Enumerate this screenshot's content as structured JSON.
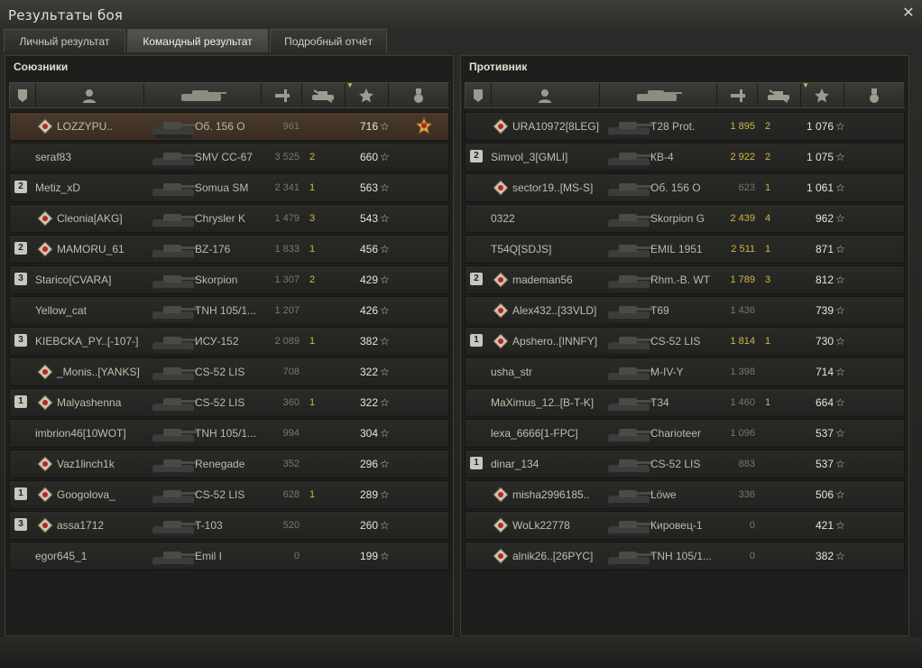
{
  "window": {
    "title": "Результаты боя",
    "close_icon": "close-icon"
  },
  "tabs": [
    {
      "label": "Личный результат"
    },
    {
      "label": "Командный результат"
    },
    {
      "label": "Подробный отчёт"
    }
  ],
  "allies": {
    "title": "Союзники",
    "rows": [
      {
        "platoon": "",
        "badge": "clan-emblem-icon",
        "name": "LOZZYPU..",
        "vehicle": "Об. 156 О",
        "damage": "961",
        "frags": "",
        "xp": "716",
        "medal": "order-medal-icon"
      },
      {
        "platoon": "",
        "badge": "",
        "name": "seraf83",
        "vehicle": "SMV CC-67",
        "damage": "3 525",
        "frags": "2",
        "xp": "660",
        "medal": ""
      },
      {
        "platoon": "2",
        "badge": "",
        "name": "Metiz_xD",
        "vehicle": "Somua SM",
        "damage": "2 341",
        "frags": "1",
        "xp": "563",
        "medal": ""
      },
      {
        "platoon": "",
        "badge": "clan-emblem-icon",
        "name": "Cleonia[AKG]",
        "vehicle": "Chrysler K",
        "damage": "1 479",
        "frags": "3",
        "xp": "543",
        "medal": ""
      },
      {
        "platoon": "2",
        "badge": "clan-emblem-icon",
        "name": "MAMORU_61",
        "vehicle": "BZ-176",
        "damage": "1 833",
        "frags": "1",
        "xp": "456",
        "medal": ""
      },
      {
        "platoon": "3",
        "badge": "",
        "name": "Starico[CVARA]",
        "vehicle": "Skorpion",
        "damage": "1 307",
        "frags": "2",
        "xp": "429",
        "medal": ""
      },
      {
        "platoon": "",
        "badge": "",
        "name": "Yellow_cat",
        "vehicle": "TNH 105/1...",
        "damage": "1 207",
        "frags": "",
        "xp": "426",
        "medal": ""
      },
      {
        "platoon": "3",
        "badge": "",
        "name": "KIEBCKA_PY..[-107-]",
        "vehicle": "ИСУ-152",
        "damage": "2 089",
        "frags": "1",
        "xp": "382",
        "medal": ""
      },
      {
        "platoon": "",
        "badge": "clan-emblem-icon",
        "name": "_Monis..[YANKS]",
        "vehicle": "CS-52 LIS",
        "damage": "708",
        "frags": "",
        "xp": "322",
        "medal": ""
      },
      {
        "platoon": "1",
        "badge": "clan-emblem-icon",
        "name": "Malyashenna",
        "vehicle": "CS-52 LIS",
        "damage": "360",
        "frags": "1",
        "xp": "322",
        "medal": ""
      },
      {
        "platoon": "",
        "badge": "",
        "name": "imbrion46[10WOT]",
        "vehicle": "TNH 105/1...",
        "damage": "994",
        "frags": "",
        "xp": "304",
        "medal": ""
      },
      {
        "platoon": "",
        "badge": "clan-emblem-icon",
        "name": "Vaz1linch1k",
        "vehicle": "Renegade",
        "damage": "352",
        "frags": "",
        "xp": "296",
        "medal": ""
      },
      {
        "platoon": "1",
        "badge": "clan-emblem-icon",
        "name": "Googolova_",
        "vehicle": "CS-52 LIS",
        "damage": "628",
        "frags": "1",
        "xp": "289",
        "medal": ""
      },
      {
        "platoon": "3",
        "badge": "clan-emblem-icon",
        "name": "assa1712",
        "vehicle": "T-103",
        "damage": "520",
        "frags": "",
        "xp": "260",
        "medal": ""
      },
      {
        "platoon": "",
        "badge": "",
        "name": "egor645_1",
        "vehicle": "Emil I",
        "damage": "0",
        "frags": "",
        "xp": "199",
        "medal": ""
      }
    ]
  },
  "enemies": {
    "title": "Противник",
    "rows": [
      {
        "platoon": "",
        "badge": "clan-emblem-icon",
        "name": "URA10972[8LEG]",
        "vehicle": "T28 Prot.",
        "damage": "1 895",
        "frags": "2",
        "xp": "1 076",
        "medal": ""
      },
      {
        "platoon": "2",
        "badge": "",
        "name": "Simvol_3[GMLI]",
        "vehicle": "КВ-4",
        "damage": "2 922",
        "frags": "2",
        "xp": "1 075",
        "medal": ""
      },
      {
        "platoon": "",
        "badge": "clan-emblem-icon",
        "name": "sector19..[MS-S]",
        "vehicle": "Об. 156 О",
        "damage": "623",
        "frags": "1",
        "xp": "1 061",
        "medal": ""
      },
      {
        "platoon": "",
        "badge": "",
        "name": "0322",
        "vehicle": "Skorpion G",
        "damage": "2 439",
        "frags": "4",
        "xp": "962",
        "medal": ""
      },
      {
        "platoon": "",
        "badge": "",
        "name": "T54Q[SDJS]",
        "vehicle": "EMIL 1951",
        "damage": "2 511",
        "frags": "1",
        "xp": "871",
        "medal": ""
      },
      {
        "platoon": "2",
        "badge": "clan-emblem-icon",
        "name": "mademan56",
        "vehicle": "Rhm.-B. WT",
        "damage": "1 789",
        "frags": "3",
        "xp": "812",
        "medal": ""
      },
      {
        "platoon": "",
        "badge": "clan-emblem-icon",
        "name": "Alex432..[33VLD]",
        "vehicle": "T69",
        "damage": "1 436",
        "frags": "",
        "xp": "739",
        "medal": ""
      },
      {
        "platoon": "1",
        "badge": "clan-emblem-icon",
        "name": "Apshero..[INNFY]",
        "vehicle": "CS-52 LIS",
        "damage": "1 814",
        "frags": "1",
        "xp": "730",
        "medal": ""
      },
      {
        "platoon": "",
        "badge": "",
        "name": "usha_str",
        "vehicle": "M-IV-Y",
        "damage": "1 398",
        "frags": "",
        "xp": "714",
        "medal": ""
      },
      {
        "platoon": "",
        "badge": "",
        "name": "MaXimus_12..[B-T-K]",
        "vehicle": "T34",
        "damage": "1 460",
        "frags": "1",
        "xp": "664",
        "medal": ""
      },
      {
        "platoon": "",
        "badge": "",
        "name": "lexa_6666[1-FPC]",
        "vehicle": "Charioteer",
        "damage": "1 096",
        "frags": "",
        "xp": "537",
        "medal": ""
      },
      {
        "platoon": "1",
        "badge": "",
        "name": "dinar_134",
        "vehicle": "CS-52 LIS",
        "damage": "883",
        "frags": "",
        "xp": "537",
        "medal": ""
      },
      {
        "platoon": "",
        "badge": "clan-emblem-icon",
        "name": "misha2996185..",
        "vehicle": "Löwe",
        "damage": "336",
        "frags": "",
        "xp": "506",
        "medal": ""
      },
      {
        "platoon": "",
        "badge": "clan-emblem-icon",
        "name": "WoLk22778",
        "vehicle": "Кировец-1",
        "damage": "0",
        "frags": "",
        "xp": "421",
        "medal": ""
      },
      {
        "platoon": "",
        "badge": "clan-emblem-icon",
        "name": "alnik26..[26PYC]",
        "vehicle": "TNH 105/1...",
        "damage": "0",
        "frags": "",
        "xp": "382",
        "medal": ""
      }
    ]
  },
  "colors": {
    "damage_highlight": "#d4b54a",
    "frags": "#d4b54a",
    "self_row": "#4a3a2c"
  }
}
